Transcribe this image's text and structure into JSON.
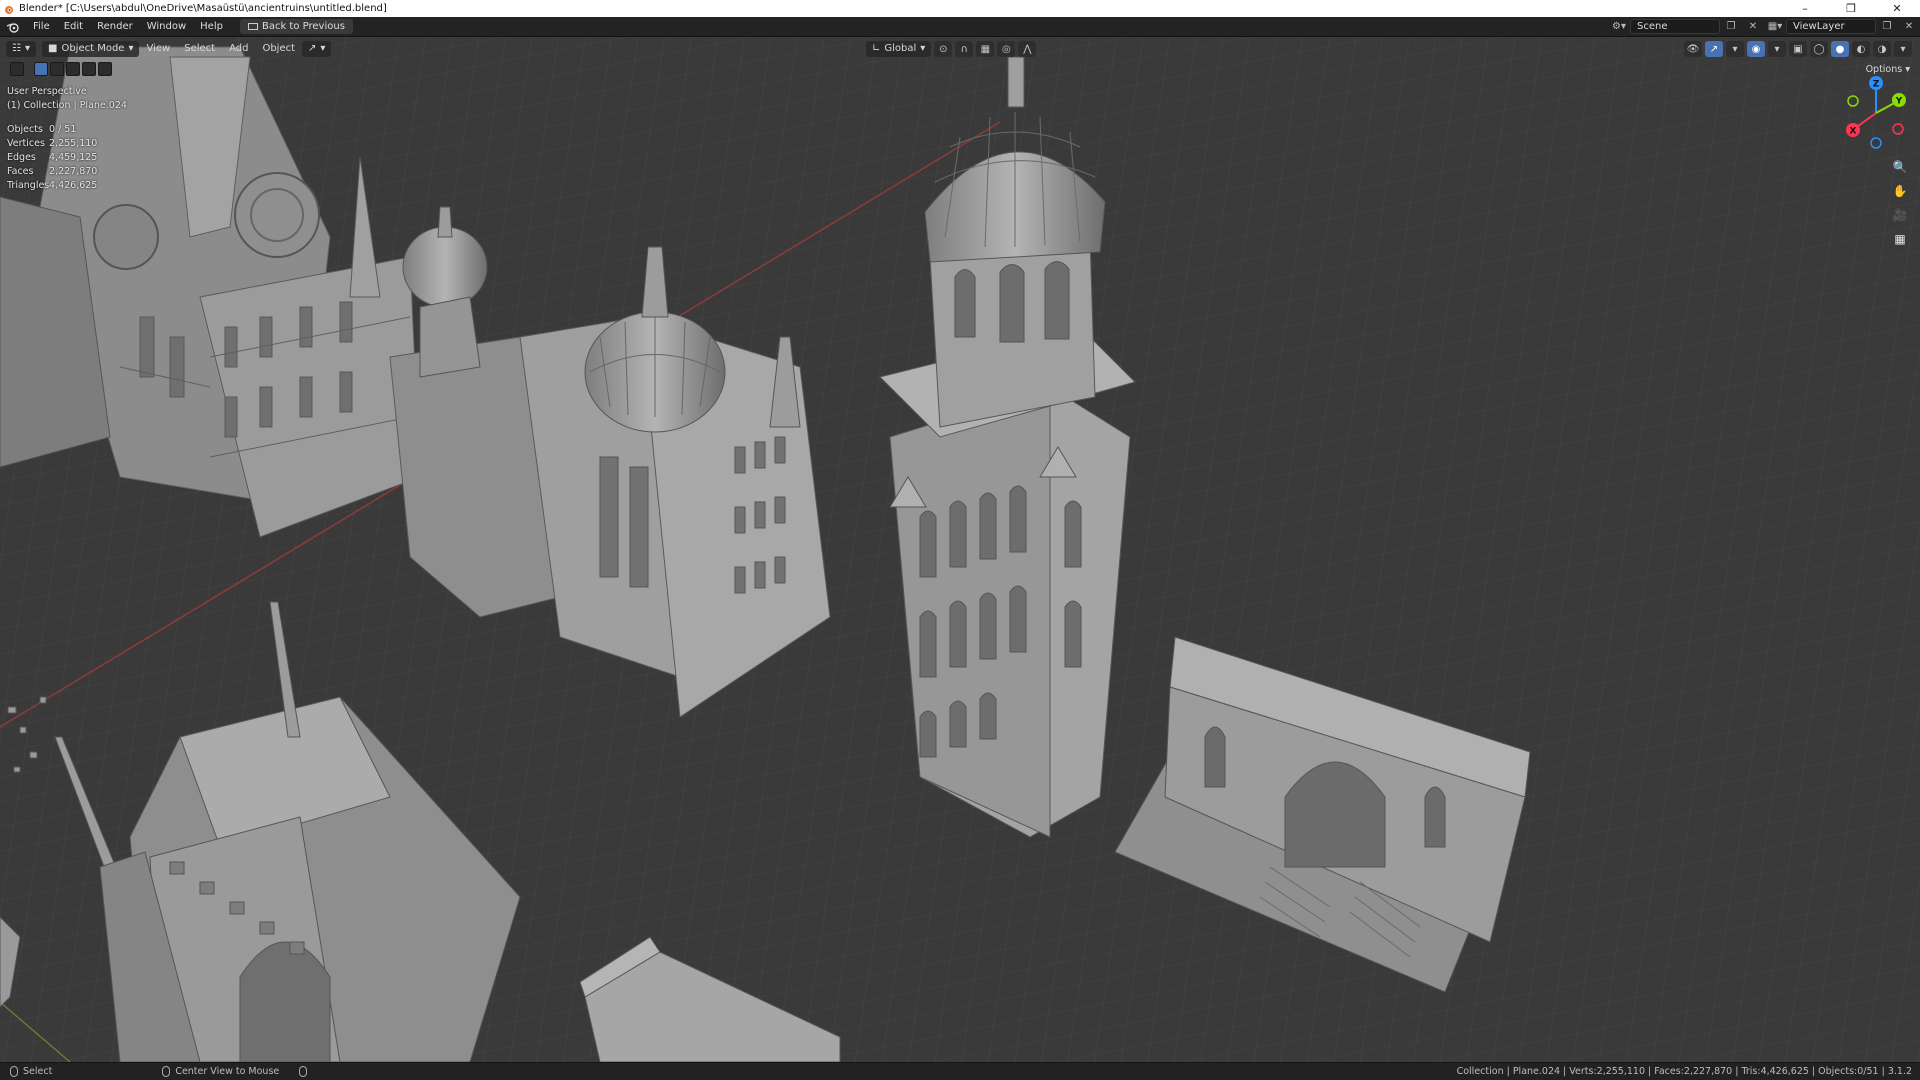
{
  "window": {
    "title": "Blender* [C:\\Users\\abdul\\OneDrive\\Masaüstü\\ancientruins\\untitled.blend]"
  },
  "menubar": {
    "items": [
      "File",
      "Edit",
      "Render",
      "Window",
      "Help"
    ],
    "back_button": "Back to Previous",
    "scene_name": "Scene",
    "view_layer": "ViewLayer"
  },
  "header": {
    "mode": "Object Mode",
    "menus": [
      "View",
      "Select",
      "Add",
      "Object"
    ],
    "transform_orientation": "Global"
  },
  "viewport": {
    "view_name": "User Perspective",
    "collection_info": "(1) Collection | Plane.024",
    "options_label": "Options",
    "stats": [
      {
        "label": "Objects",
        "value": "0 / 51"
      },
      {
        "label": "Vertices",
        "value": "2,255,110"
      },
      {
        "label": "Edges",
        "value": "4,459,125"
      },
      {
        "label": "Faces",
        "value": "2,227,870"
      },
      {
        "label": "Triangles",
        "value": "4,426,625"
      }
    ],
    "gizmo_axes": [
      "X",
      "Y",
      "Z"
    ]
  },
  "statusbar": {
    "left_action": "Select",
    "middle_action": "Center View to Mouse",
    "summary": "Collection | Plane.024 | Verts:2,255,110 | Faces:2,227,870 | Tris:4,426,625 | Objects:0/51 | 3.1.2"
  },
  "colors": {
    "accent": "#4772b3",
    "axis_x": "#ff3352",
    "axis_y": "#8bdc00",
    "axis_z": "#2890ff",
    "viewport_bg": "#3b3b3b",
    "model_gray": "#9a9a9a"
  }
}
